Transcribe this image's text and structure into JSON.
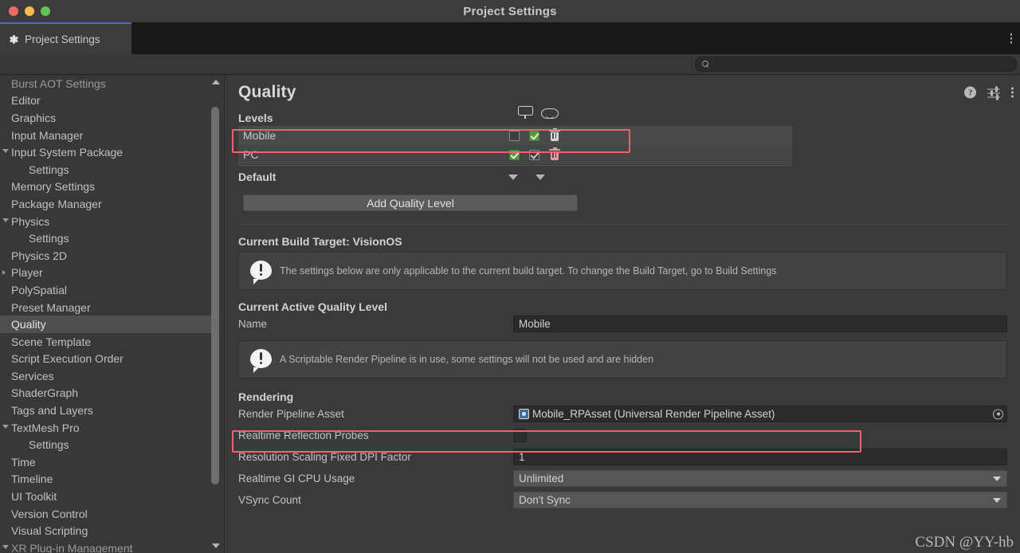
{
  "window": {
    "title": "Project Settings",
    "traffic_lights": [
      "close",
      "minimize",
      "maximize"
    ]
  },
  "tab": {
    "label": "Project Settings",
    "icon": "gear-icon",
    "overflow_menu": "kebab-menu-icon"
  },
  "toolbar": {
    "search_value": "",
    "search_placeholder": "",
    "search_icon": "search-icon"
  },
  "sidebar": {
    "items": [
      {
        "label": "Burst AOT Settings",
        "indent": false,
        "foldout": "none",
        "selected": false,
        "clipped": true
      },
      {
        "label": "Editor",
        "indent": false,
        "foldout": "none",
        "selected": false
      },
      {
        "label": "Graphics",
        "indent": false,
        "foldout": "none",
        "selected": false
      },
      {
        "label": "Input Manager",
        "indent": false,
        "foldout": "none",
        "selected": false
      },
      {
        "label": "Input System Package",
        "indent": false,
        "foldout": "open",
        "selected": false
      },
      {
        "label": "Settings",
        "indent": true,
        "foldout": "none",
        "selected": false
      },
      {
        "label": "Memory Settings",
        "indent": false,
        "foldout": "none",
        "selected": false
      },
      {
        "label": "Package Manager",
        "indent": false,
        "foldout": "none",
        "selected": false
      },
      {
        "label": "Physics",
        "indent": false,
        "foldout": "open",
        "selected": false
      },
      {
        "label": "Settings",
        "indent": true,
        "foldout": "none",
        "selected": false
      },
      {
        "label": "Physics 2D",
        "indent": false,
        "foldout": "none",
        "selected": false
      },
      {
        "label": "Player",
        "indent": false,
        "foldout": "closed",
        "selected": false
      },
      {
        "label": "PolySpatial",
        "indent": false,
        "foldout": "none",
        "selected": false
      },
      {
        "label": "Preset Manager",
        "indent": false,
        "foldout": "none",
        "selected": false
      },
      {
        "label": "Quality",
        "indent": false,
        "foldout": "none",
        "selected": true
      },
      {
        "label": "Scene Template",
        "indent": false,
        "foldout": "none",
        "selected": false
      },
      {
        "label": "Script Execution Order",
        "indent": false,
        "foldout": "none",
        "selected": false
      },
      {
        "label": "Services",
        "indent": false,
        "foldout": "none",
        "selected": false
      },
      {
        "label": "ShaderGraph",
        "indent": false,
        "foldout": "none",
        "selected": false
      },
      {
        "label": "Tags and Layers",
        "indent": false,
        "foldout": "none",
        "selected": false
      },
      {
        "label": "TextMesh Pro",
        "indent": false,
        "foldout": "open",
        "selected": false
      },
      {
        "label": "Settings",
        "indent": true,
        "foldout": "none",
        "selected": false
      },
      {
        "label": "Time",
        "indent": false,
        "foldout": "none",
        "selected": false
      },
      {
        "label": "Timeline",
        "indent": false,
        "foldout": "none",
        "selected": false
      },
      {
        "label": "UI Toolkit",
        "indent": false,
        "foldout": "none",
        "selected": false
      },
      {
        "label": "Version Control",
        "indent": false,
        "foldout": "none",
        "selected": false
      },
      {
        "label": "Visual Scripting",
        "indent": false,
        "foldout": "none",
        "selected": false
      },
      {
        "label": "XR Plug-in Management",
        "indent": false,
        "foldout": "open",
        "selected": false,
        "clipped": true
      }
    ]
  },
  "page": {
    "title": "Quality",
    "help_icon": "help-icon",
    "preset_icon": "preset-settings-icon",
    "menu_icon": "kebab-menu-icon"
  },
  "levels": {
    "section_label": "Levels",
    "platform_columns": [
      "desktop-monitor-icon",
      "vision-headset-icon"
    ],
    "rows": [
      {
        "name": "Mobile",
        "desktop_checked": false,
        "vision_checked": true,
        "vision_style": "green",
        "delete_icon": "trash-icon",
        "highlighted": true
      },
      {
        "name": "PC",
        "desktop_checked": true,
        "vision_checked": true,
        "vision_style": "grey",
        "delete_icon": "trash-icon",
        "highlighted": false
      }
    ],
    "default_label": "Default",
    "default_dropdowns": [
      "chevron-down-icon",
      "chevron-down-icon"
    ],
    "add_button": "Add Quality Level"
  },
  "build_target": {
    "heading": "Current Build Target: VisionOS",
    "info_icon": "warning-icon",
    "info_message": "The settings below are only applicable to the current build target. To change the Build Target, go to Build Settings"
  },
  "active_level": {
    "heading": "Current Active Quality Level",
    "name_label": "Name",
    "name_value": "Mobile",
    "srp_info_icon": "warning-icon",
    "srp_info_message": "A Scriptable Render Pipeline is in use, some settings will not be used and are hidden"
  },
  "rendering": {
    "heading": "Rendering",
    "fields": [
      {
        "label": "Render Pipeline Asset",
        "value": "Mobile_RPAsset (Universal Render Pipeline Asset)",
        "type": "object",
        "asset_icon": "render-pipeline-asset-icon",
        "picker_icon": "object-picker-icon",
        "highlighted": true
      },
      {
        "label": "Realtime Reflection Probes",
        "value": "",
        "type": "checkbox",
        "checked": false
      },
      {
        "label": "Resolution Scaling Fixed DPI Factor",
        "value": "1",
        "type": "text"
      },
      {
        "label": "Realtime GI CPU Usage",
        "value": "Unlimited",
        "type": "dropdown"
      },
      {
        "label": "VSync Count",
        "value": "Don't Sync",
        "type": "dropdown"
      }
    ]
  },
  "watermark": {
    "text": "CSDN @YY-hb"
  },
  "colors": {
    "accent_blue": "#4a73a8",
    "annotation_red": "#f4606c",
    "checkbox_green": "#4f9e3c",
    "panel_bg": "#3a3a3a",
    "selection": "#4f4f4f"
  }
}
